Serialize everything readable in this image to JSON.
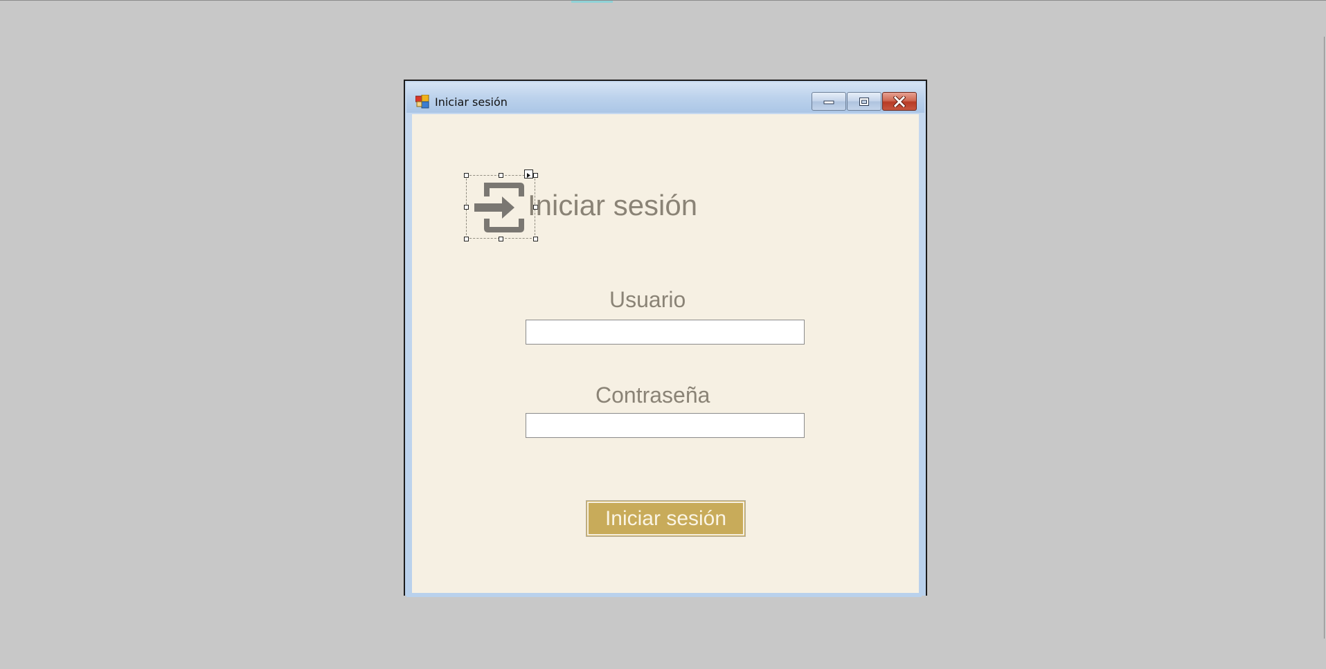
{
  "window": {
    "title": "Iniciar sesión"
  },
  "icons": {
    "app": "application-icon",
    "form": "login-icon"
  },
  "form": {
    "heading": "Iniciar sesión",
    "username_label": "Usuario",
    "username_value": "",
    "password_label": "Contraseña",
    "password_value": "",
    "submit_label": "Iniciar sesión"
  },
  "colors": {
    "client_background": "#f6f0e3",
    "text_gray": "#8a8376",
    "button_gold": "#c8ab5a",
    "button_text": "#faf4e4"
  }
}
